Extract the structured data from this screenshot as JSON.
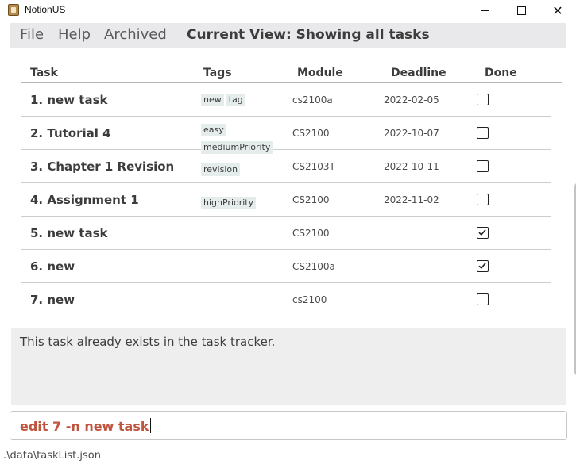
{
  "window": {
    "title": "NotionUS",
    "minimize_icon": "minimize-icon",
    "maximize_icon": "maximize-icon",
    "close_label": "✕"
  },
  "menu": {
    "file": "File",
    "help": "Help",
    "archived": "Archived",
    "current_view": "Current View: Showing all tasks"
  },
  "table": {
    "headers": {
      "task": "Task",
      "tags": "Tags",
      "module": "Module",
      "deadline": "Deadline",
      "done": "Done"
    },
    "rows": [
      {
        "task": "1. new task",
        "tags": [
          "new",
          "tag"
        ],
        "module": "cs2100a",
        "deadline": "2022-02-05",
        "done": false
      },
      {
        "task": "2. Tutorial 4",
        "tags": [
          "easy",
          "mediumPriority"
        ],
        "module": "CS2100",
        "deadline": "2022-10-07",
        "done": false
      },
      {
        "task": "3. Chapter 1 Revision",
        "tags": [
          "revision"
        ],
        "module": "CS2103T",
        "deadline": "2022-10-11",
        "done": false
      },
      {
        "task": "4. Assignment 1",
        "tags": [
          "highPriority"
        ],
        "module": "CS2100",
        "deadline": "2022-11-02",
        "done": false
      },
      {
        "task": "5. new task",
        "tags": [],
        "module": "CS2100",
        "deadline": "",
        "done": true
      },
      {
        "task": "6. new",
        "tags": [],
        "module": "CS2100a",
        "deadline": "",
        "done": true
      },
      {
        "task": "7. new",
        "tags": [],
        "module": "cs2100",
        "deadline": "",
        "done": false
      }
    ]
  },
  "result": {
    "message": "This task already exists in the task tracker."
  },
  "command": {
    "value": "edit 7 -n new task"
  },
  "status": {
    "path": ".\\data\\taskList.json"
  },
  "colors": {
    "command_text": "#c0553f",
    "tag_bg": "#e4ecec",
    "menubar_bg": "#e9e9ec",
    "result_bg": "#eeeeee"
  }
}
